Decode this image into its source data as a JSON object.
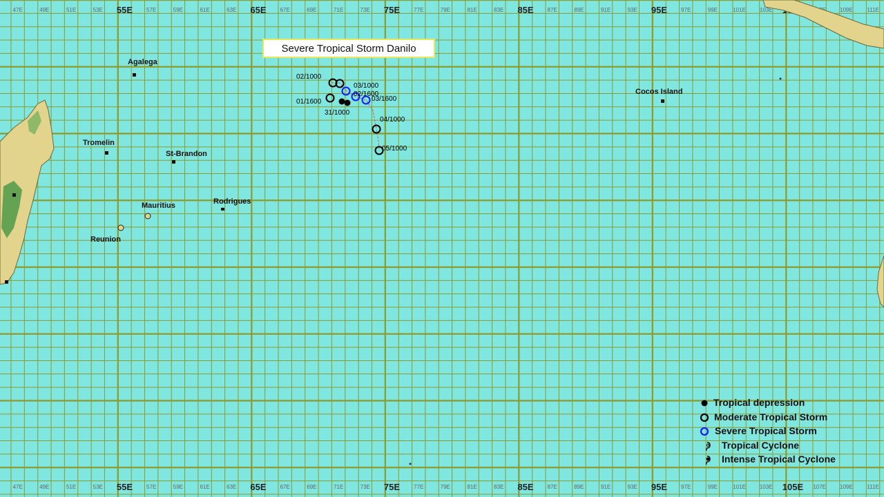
{
  "title": "Severe Tropical Storm Danilo",
  "axis": {
    "top_labels": [
      "47E",
      "49E",
      "51E",
      "53E",
      "55E",
      "57E",
      "59E",
      "61E",
      "63E",
      "65E",
      "67E",
      "69E",
      "71E",
      "73E",
      "75E",
      "77E",
      "79E",
      "81E",
      "83E",
      "85E",
      "87E",
      "89E",
      "91E",
      "93E",
      "95E",
      "97E",
      "99E",
      "101E",
      "103E",
      "105E",
      "107E",
      "109E",
      "111E"
    ],
    "bottom_labels": [
      "47E",
      "49E",
      "51E",
      "53E",
      "55E",
      "57E",
      "59E",
      "61E",
      "63E",
      "65E",
      "67E",
      "69E",
      "71E",
      "73E",
      "75E",
      "77E",
      "79E",
      "81E",
      "83E",
      "85E",
      "87E",
      "89E",
      "91E",
      "93E",
      "95E",
      "97E",
      "99E",
      "101E",
      "103E",
      "105E",
      "107E",
      "109E",
      "111E"
    ],
    "major_labels": [
      "55E",
      "65E",
      "75E",
      "85E",
      "95E",
      "105E"
    ]
  },
  "places": [
    {
      "name": "Agalega"
    },
    {
      "name": "Tromelin"
    },
    {
      "name": "St-Brandon"
    },
    {
      "name": "Mauritius"
    },
    {
      "name": "Reunion"
    },
    {
      "name": "Rodrigues"
    },
    {
      "name": "Cocos Island"
    }
  ],
  "track_labels": [
    "02/1000",
    "01/1600",
    "31/1000",
    "03/1000",
    "02/1600",
    "03/1600",
    "04/1000",
    "05/1000"
  ],
  "legend": [
    {
      "label": "Tropical depression",
      "icon": "filled-dot"
    },
    {
      "label": "Moderate Tropical Storm",
      "icon": "black-circle"
    },
    {
      "label": "Severe Tropical Storm",
      "icon": "blue-circle"
    },
    {
      "label": "Tropical Cyclone",
      "icon": "cyclone-symbol"
    },
    {
      "label": "Intense Tropical Cyclone",
      "icon": "intense-cyclone-symbol"
    }
  ],
  "colors": {
    "ocean": "#7fe6e0",
    "grid": "#8c9a2e",
    "land": "#e2d48c",
    "moderate_storm": "#000000",
    "severe_storm": "#1a1aff",
    "track": "#c06060"
  }
}
